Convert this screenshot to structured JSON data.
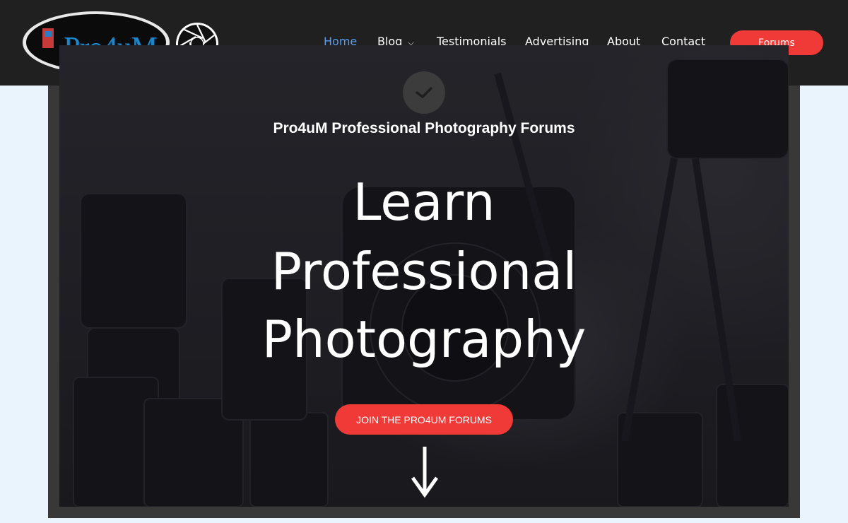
{
  "header": {
    "logo_text": "Pro4uM",
    "nav": [
      {
        "label": "Home",
        "active": true
      },
      {
        "label": "Blog",
        "has_dropdown": true
      },
      {
        "label": "Testimonials"
      },
      {
        "label": "Advertising"
      },
      {
        "label": "About"
      },
      {
        "label": "Contact"
      }
    ],
    "forums_button": "Forums"
  },
  "hero": {
    "tagline": "Pro4uM Professional Photography Forums",
    "headline_lines": [
      "Learn",
      "Professional",
      "Photography"
    ],
    "cta": "JOIN THE PRO4UM FORUMS"
  },
  "colors": {
    "accent": "#ef3a37",
    "nav_active": "#5a9cf0",
    "header_bg": "#202020",
    "page_bg": "#e9f4fd"
  },
  "icons": {
    "badge": "checkmark-icon",
    "scroll": "down-arrow-icon",
    "dropdown": "chevron-down-icon",
    "logo_mark": "aperture-icon"
  }
}
